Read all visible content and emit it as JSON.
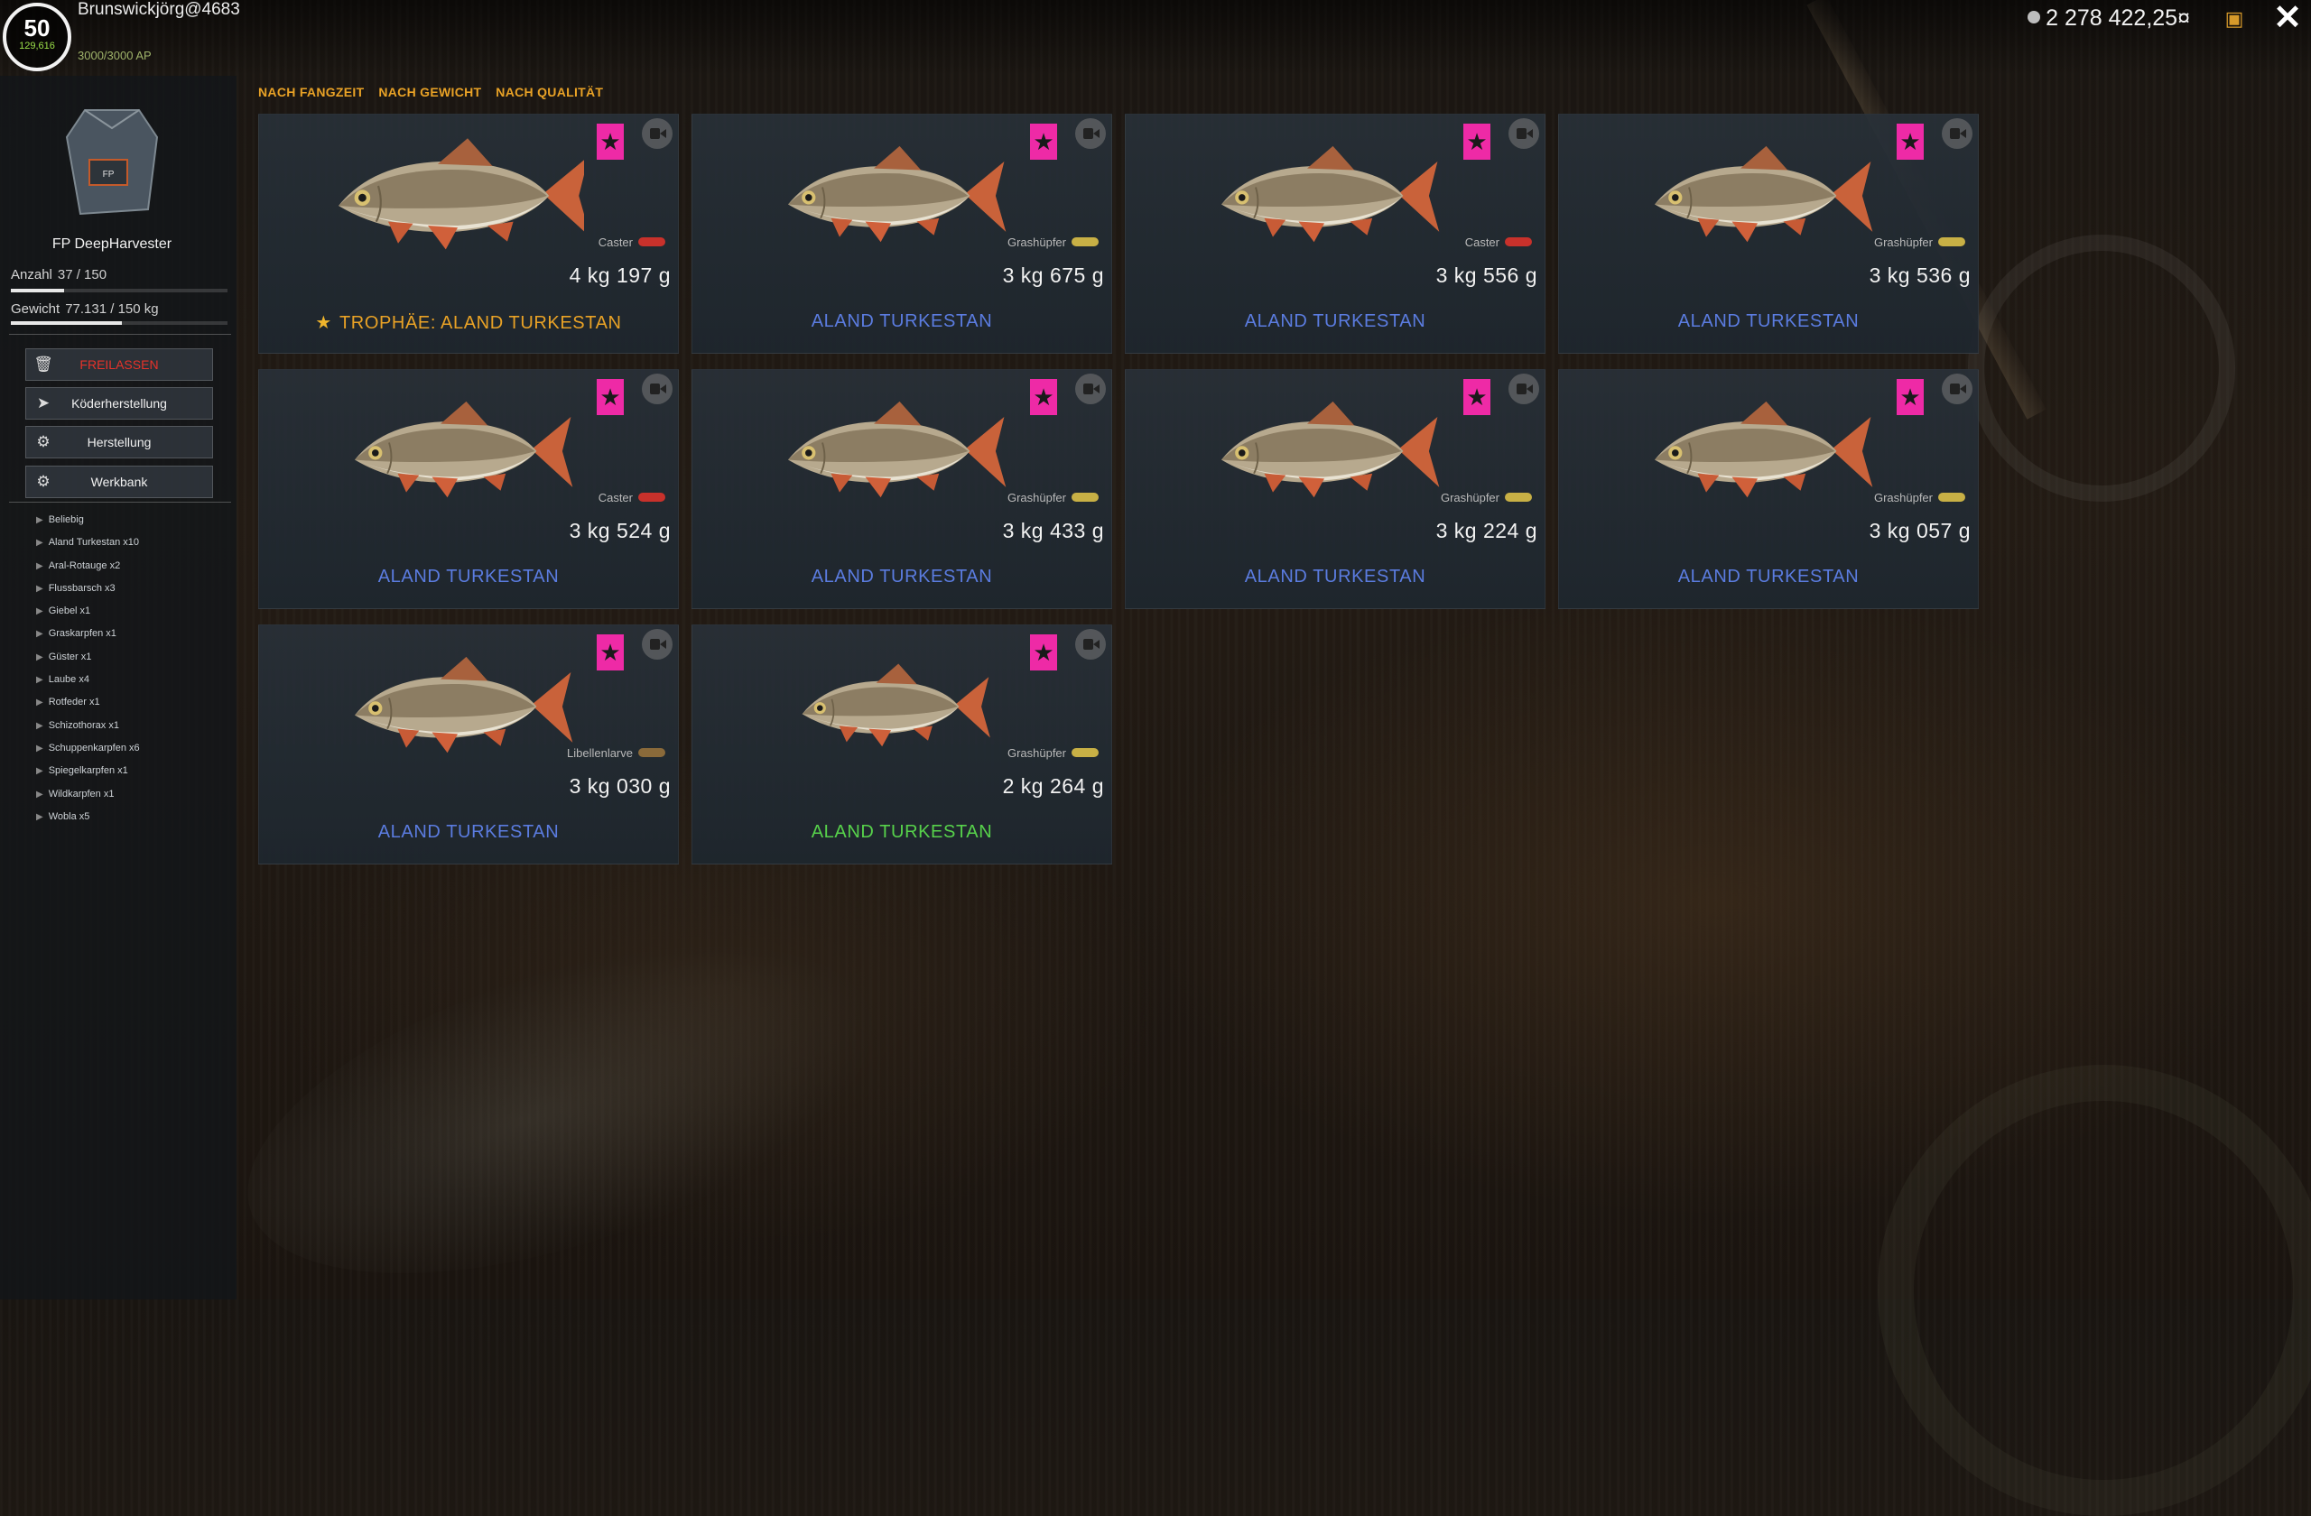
{
  "player": {
    "level": "50",
    "level_sub": "129,616",
    "name": "Brunswickjörg@4683",
    "ap": "3000/3000 AP"
  },
  "currency": "2 278 422,25¤",
  "keepnet": {
    "name": "FP DeepHarvester",
    "count_label": "Anzahl",
    "count_value": "37 / 150",
    "count_fraction": 0.247,
    "weight_label": "Gewicht",
    "weight_value": "77.131 / 150 kg",
    "weight_fraction": 0.514
  },
  "actions": {
    "release": "FREILASSEN",
    "lure": "Köderherstellung",
    "craft": "Herstellung",
    "bench": "Werkbank"
  },
  "tree": [
    "Beliebig",
    "Aland Turkestan x10",
    "Aral-Rotauge x2",
    "Flussbarsch x3",
    "Giebel x1",
    "Graskarpfen x1",
    "Güster x1",
    "Laube x4",
    "Rotfeder x1",
    "Schizothorax x1",
    "Schuppenkarpfen x6",
    "Spiegelkarpfen x1",
    "Wildkarpfen x1",
    "Wobla x5"
  ],
  "sort": [
    "NACH FANGZEIT",
    "NACH GEWICHT",
    "NACH QUALITÄT"
  ],
  "cards": [
    {
      "bait": "Caster",
      "weight": "4 kg 197 g",
      "title": "TROPHÄE: ALAND TURKESTAN",
      "kind": "trophy"
    },
    {
      "bait": "Grashüpfer",
      "weight": "3 kg 675 g",
      "title": "ALAND TURKESTAN",
      "kind": "blue"
    },
    {
      "bait": "Caster",
      "weight": "3 kg 556 g",
      "title": "ALAND TURKESTAN",
      "kind": "blue"
    },
    {
      "bait": "Grashüpfer",
      "weight": "3 kg 536 g",
      "title": "ALAND TURKESTAN",
      "kind": "blue"
    },
    {
      "bait": "Caster",
      "weight": "3 kg 524 g",
      "title": "ALAND TURKESTAN",
      "kind": "blue"
    },
    {
      "bait": "Grashüpfer",
      "weight": "3 kg 433 g",
      "title": "ALAND TURKESTAN",
      "kind": "blue"
    },
    {
      "bait": "Grashüpfer",
      "weight": "3 kg 224 g",
      "title": "ALAND TURKESTAN",
      "kind": "blue"
    },
    {
      "bait": "Grashüpfer",
      "weight": "3 kg 057 g",
      "title": "ALAND TURKESTAN",
      "kind": "blue"
    },
    {
      "bait": "Libellenlarve",
      "weight": "3 kg 030 g",
      "title": "ALAND TURKESTAN",
      "kind": "blue"
    },
    {
      "bait": "Grashüpfer",
      "weight": "2 kg 264 g",
      "title": "ALAND TURKESTAN",
      "kind": "green"
    }
  ],
  "icons": {
    "favorite": "star-icon",
    "video": "camera-icon",
    "trash": "trash-icon",
    "lure": "lure-icon",
    "gear": "gear-icon",
    "bench": "workbench-icon",
    "close": "close-icon",
    "bag": "bag-icon",
    "coin": "coin-icon"
  },
  "colors": {
    "accent": "#e9a226",
    "favorite": "#ee2aa6",
    "title_blue": "#5b7ce0",
    "title_green": "#57d24b",
    "release": "#e6322a"
  }
}
